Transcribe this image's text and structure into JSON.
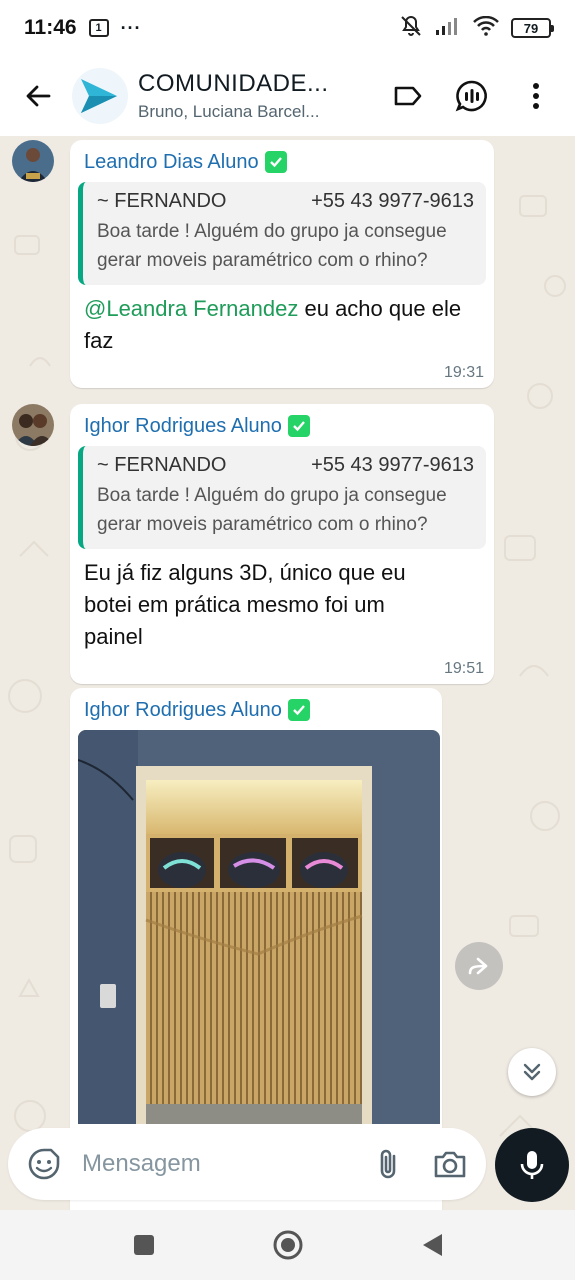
{
  "status_bar": {
    "time": "11:46",
    "sim_label": "1",
    "more_dots": "···",
    "battery": "79"
  },
  "header": {
    "group_name": "COMUNIDADE...",
    "members": "Bruno, Luciana Barcel..."
  },
  "messages": [
    {
      "sender": "Leandro Dias Aluno",
      "quote_author": "~ FERNANDO",
      "quote_phone": "+55 43 9977-9613",
      "quote_text": "Boa tarde ! Alguém do grupo ja consegue gerar moveis paramétrico com o rhino?",
      "mention": "@Leandra Fernandez",
      "text": " eu acho que ele faz",
      "time": "19:31"
    },
    {
      "sender": "Ighor Rodrigues Aluno",
      "quote_author": "~ FERNANDO",
      "quote_phone": "+55 43 9977-9613",
      "quote_text": "Boa tarde ! Alguém do grupo ja consegue gerar moveis paramétrico com o rhino?",
      "text": "Eu já fiz alguns 3D, único que eu botei em prática mesmo foi um painel",
      "time": "19:51"
    },
    {
      "sender": "Ighor Rodrigues Aluno",
      "type": "image"
    }
  ],
  "composer": {
    "placeholder": "Mensagem"
  },
  "colors": {
    "sender_name": "#1f6fb0",
    "mention": "#1f9c59",
    "quote_bar": "#06a884",
    "chat_bg": "#efeae2"
  },
  "icons": [
    "back-arrow-icon",
    "group-logo-icon",
    "label-icon",
    "community-icon",
    "more-vert-icon",
    "verified-icon",
    "forward-icon",
    "double-chevron-down-icon",
    "sticker-icon",
    "attach-icon",
    "camera-icon",
    "mic-icon",
    "nav-square-icon",
    "nav-circle-icon",
    "nav-back-icon",
    "mute-icon",
    "signal-icon",
    "wifi-icon"
  ]
}
